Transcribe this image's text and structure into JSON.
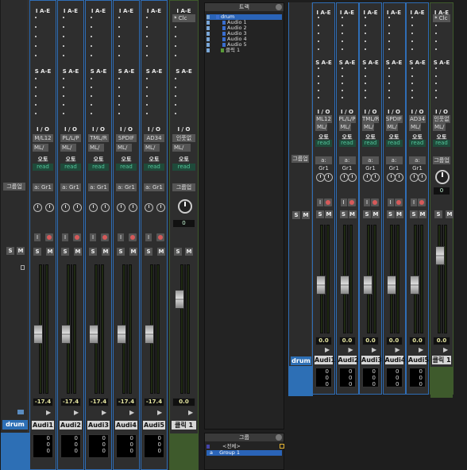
{
  "left_mixer": {
    "drum_strip": {
      "group_label": "그룹업",
      "name": "drum",
      "s": "S",
      "m": "M"
    },
    "channels": [
      {
        "insert_header": "I A-E",
        "send_header": "S A-E",
        "io": "I / O",
        "input": "M/L12",
        "output": "ML/",
        "auto": "오토",
        "auto_mode": "read",
        "group": "a: Gr1",
        "vol": "-17.4",
        "name": "Audi1",
        "counts": [
          "0",
          "0",
          "0"
        ]
      },
      {
        "insert_header": "I A-E",
        "send_header": "S A-E",
        "io": "I / O",
        "input": "PL/L/P",
        "output": "ML/",
        "auto": "오토",
        "auto_mode": "read",
        "group": "a: Gr1",
        "vol": "-17.4",
        "name": "Audi2",
        "counts": [
          "0",
          "0",
          "0"
        ]
      },
      {
        "insert_header": "I A-E",
        "send_header": "S A-E",
        "io": "I / O",
        "input": "TML/R",
        "output": "ML/",
        "auto": "오토",
        "auto_mode": "read",
        "group": "a: Gr1",
        "vol": "-17.4",
        "name": "Audi3",
        "counts": [
          "0",
          "0",
          "0"
        ]
      },
      {
        "insert_header": "I A-E",
        "send_header": "S A-E",
        "io": "I / O",
        "input": "SPDIF",
        "output": "ML/",
        "auto": "오토",
        "auto_mode": "read",
        "group": "a: Gr1",
        "vol": "-17.4",
        "name": "Audi4",
        "counts": [
          "0",
          "0",
          "0"
        ]
      },
      {
        "insert_header": "I A-E",
        "send_header": "S A-E",
        "io": "I / O",
        "input": "AD34",
        "output": "ML/",
        "auto": "오토",
        "auto_mode": "read",
        "group": "a: Gr1",
        "vol": "-17.4",
        "name": "Audi5",
        "counts": [
          "0",
          "0",
          "0"
        ]
      }
    ],
    "click": {
      "insert_header": "I A-E",
      "insert1": "Clc",
      "send_header": "S A-E",
      "io": "I / O",
      "input": "인풋없",
      "output": "ML/",
      "auto": "오토",
      "auto_mode": "read",
      "group": "그룹업",
      "pan_value": "0",
      "vol": "0.0",
      "name": "클릭 1"
    }
  },
  "tracks_panel": {
    "title": "트랙",
    "rows": [
      "drum",
      "Audio 1",
      "Audio 2",
      "Audio 3",
      "Audio 4",
      "Audio 5",
      "클릭 1"
    ]
  },
  "groups_panel": {
    "title": "그룹",
    "rows": [
      "<전체>",
      "Group 1"
    ],
    "group_letter": "a"
  },
  "right_mixer": {
    "drum_strip": {
      "group_label": "그룹업",
      "name": "drum",
      "s": "S",
      "m": "M"
    },
    "channels": [
      {
        "insert_header": "I A-E",
        "send_header": "S A-E",
        "io": "I / O",
        "input": "ML12",
        "output": "ML/",
        "auto": "오토",
        "auto_mode": "read",
        "group": "a: Gr1",
        "vol": "0.0",
        "name": "Audi1",
        "counts": [
          "0",
          "0",
          "0"
        ]
      },
      {
        "insert_header": "I A-E",
        "send_header": "S A-E",
        "io": "I / O",
        "input": "PL/L/P",
        "output": "ML/",
        "auto": "오토",
        "auto_mode": "read",
        "group": "a: Gr1",
        "vol": "0.0",
        "name": "Audi2",
        "counts": [
          "0",
          "0",
          "0"
        ]
      },
      {
        "insert_header": "I A-E",
        "send_header": "S A-E",
        "io": "I / O",
        "input": "TML/R",
        "output": "ML/",
        "auto": "오토",
        "auto_mode": "read",
        "group": "a: Gr1",
        "vol": "0.0",
        "name": "Audi3",
        "counts": [
          "0",
          "0",
          "0"
        ]
      },
      {
        "insert_header": "I A-E",
        "send_header": "S A-E",
        "io": "I / O",
        "input": "SPDIF",
        "output": "ML/",
        "auto": "오토",
        "auto_mode": "read",
        "group": "a: Gr1",
        "vol": "0.0",
        "name": "Audi4",
        "counts": [
          "0",
          "0",
          "0"
        ]
      },
      {
        "insert_header": "I A-E",
        "send_header": "S A-E",
        "io": "I / O",
        "input": "AD34",
        "output": "ML/",
        "auto": "오토",
        "auto_mode": "read",
        "group": "a: Gr1",
        "vol": "0.0",
        "name": "Audi5",
        "counts": [
          "0",
          "0",
          "0"
        ]
      }
    ],
    "click": {
      "insert_header": "I A-E",
      "insert1": "Clc",
      "send_header": "S A-E",
      "io": "I / O",
      "input": "인풋없",
      "output": "ML/",
      "auto": "오토",
      "auto_mode": "read",
      "group": "그룹업",
      "pan_value": "0",
      "vol": "0.0",
      "name": "클릭 1"
    }
  },
  "colors": {
    "selected_border": "#2f6db5",
    "master_border": "#3e5a2c",
    "auto_green": "#53c79c",
    "meter_green": "#1f2a12"
  }
}
